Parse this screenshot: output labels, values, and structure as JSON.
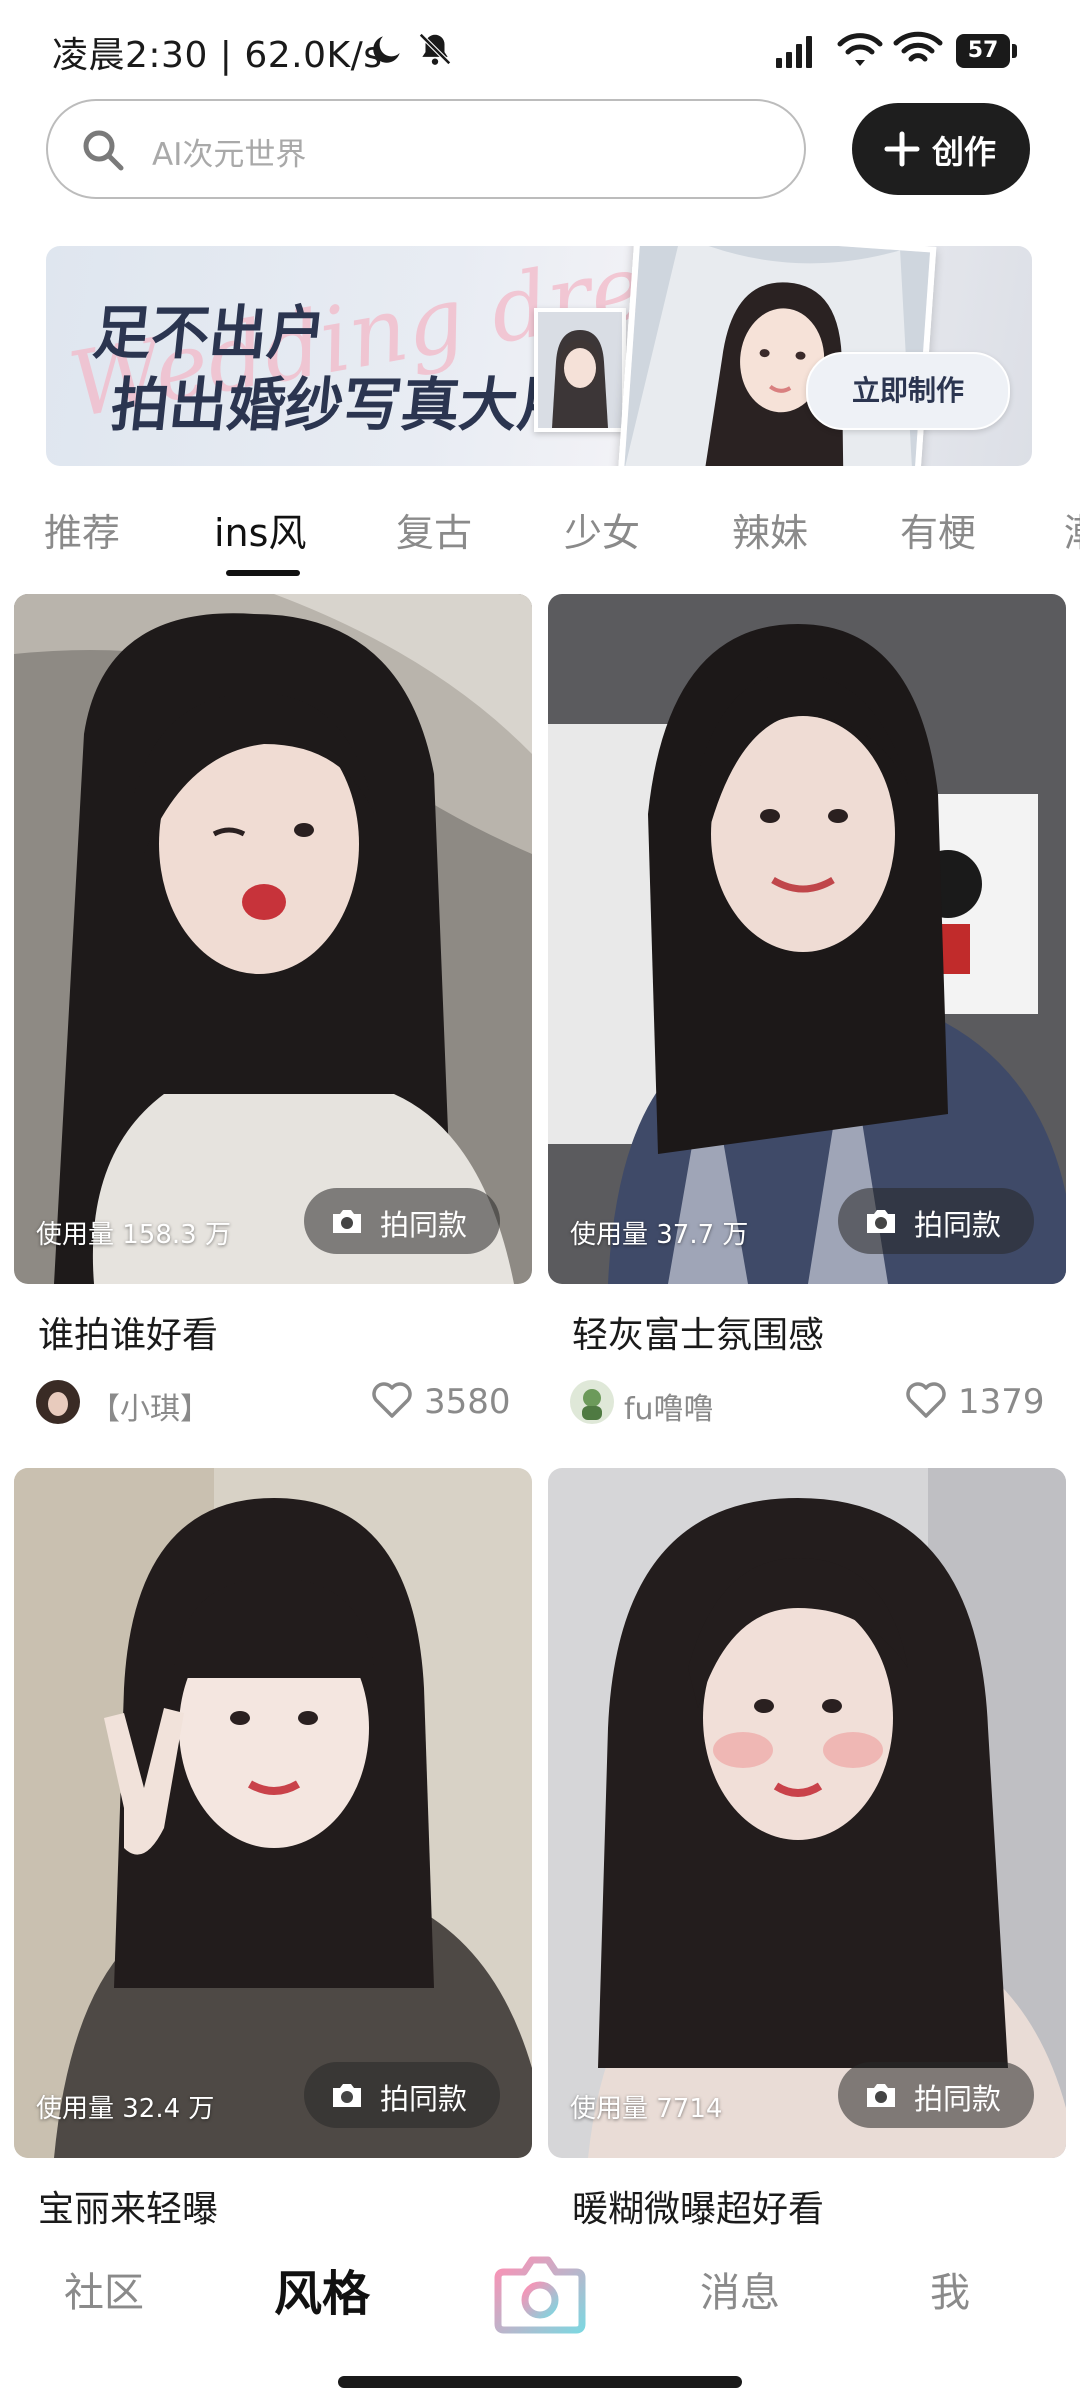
{
  "status_bar": {
    "time_speed": "凌晨2:30 | 62.0K/s",
    "battery": "57"
  },
  "search": {
    "placeholder": "AI次元世界"
  },
  "create_button": {
    "label": "创作"
  },
  "banner": {
    "script_text": "Wedding dress",
    "line1": "足不出户",
    "line2": "拍出婚纱写真大片",
    "cta": "立即制作"
  },
  "tabs": [
    {
      "label": "推荐"
    },
    {
      "label": "ins风",
      "active": true
    },
    {
      "label": "复古"
    },
    {
      "label": "少女"
    },
    {
      "label": "辣妹"
    },
    {
      "label": "有梗"
    },
    {
      "label": "潮"
    }
  ],
  "action_label": "拍同款",
  "cards": [
    {
      "usage": "使用量 158.3 万",
      "title": "谁拍谁好看",
      "author": "【小琪】",
      "likes": "3580"
    },
    {
      "usage": "使用量 37.7 万",
      "title": "轻灰富士氛围感",
      "author": "fu噜噜",
      "likes": "1379"
    },
    {
      "usage": "使用量 32.4 万",
      "title": "宝丽来轻曝"
    },
    {
      "usage": "使用量 7714",
      "title": "暖糊微曝超好看"
    }
  ],
  "bottom_nav": [
    {
      "label": "社区"
    },
    {
      "label": "风格",
      "active": true
    },
    {
      "label": "消息"
    },
    {
      "label": "我"
    }
  ],
  "colors": {
    "primary_dark": "#1e1e1e",
    "camera_gradient_start": "#ff8fb3",
    "camera_gradient_end": "#7fd6e0"
  }
}
